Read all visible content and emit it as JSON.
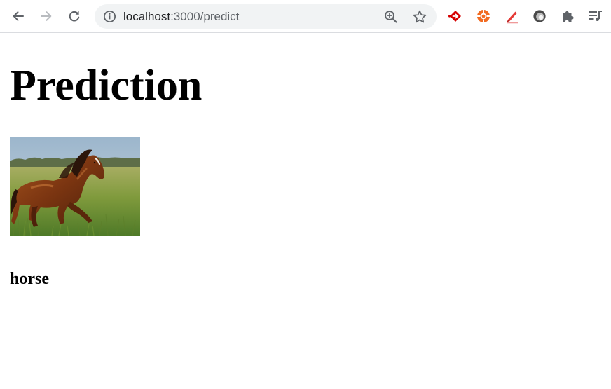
{
  "browser": {
    "url_host": "localhost",
    "url_rest": ":3000/predict",
    "icons": {
      "back": "arrow-left-icon",
      "forward": "arrow-right-icon",
      "reload": "reload-icon",
      "site_info": "info-icon",
      "zoom": "zoom-in-icon",
      "bookmark": "star-icon",
      "extensions": [
        "red-diamond-extension-icon",
        "orange-lifebuoy-extension-icon",
        "red-pen-extension-icon",
        "grey-circle-extension-icon",
        "puzzle-icon",
        "media-queue-icon"
      ]
    },
    "forward_enabled": false
  },
  "page": {
    "title": "Prediction",
    "image_alt_subject": "horse-photo",
    "prediction_label": "horse"
  },
  "colors": {
    "toolbar_icon": "#5f6368",
    "omnibox_bg": "#f1f3f4",
    "ext_red": "#d50000",
    "ext_orange": "#f26b21"
  }
}
